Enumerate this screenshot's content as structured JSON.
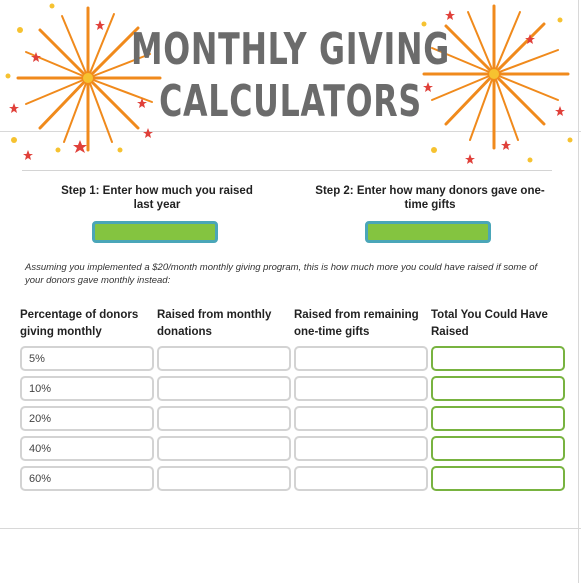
{
  "header": {
    "title_line1": "MONTHLY GIVING",
    "title_line2": "CALCULATORS"
  },
  "steps": {
    "step1_label": "Step 1: Enter how much you raised last year",
    "step1_value": "",
    "step2_label": "Step 2: Enter how many donors gave one-time gifts",
    "step2_value": ""
  },
  "note": "Assuming you implemented a $20/month monthly giving program, this is how much more you could have raised if some of your donors gave monthly instead:",
  "table": {
    "headers": [
      "Percentage of donors giving monthly",
      "Raised from monthly donations",
      "Raised from remaining one-time gifts",
      "Total You Could Have Raised"
    ],
    "rows": [
      {
        "percent": "5%",
        "monthly": "",
        "one_time": "",
        "total": ""
      },
      {
        "percent": "10%",
        "monthly": "",
        "one_time": "",
        "total": ""
      },
      {
        "percent": "20%",
        "monthly": "",
        "one_time": "",
        "total": ""
      },
      {
        "percent": "40%",
        "monthly": "",
        "one_time": "",
        "total": ""
      },
      {
        "percent": "60%",
        "monthly": "",
        "one_time": "",
        "total": ""
      }
    ]
  },
  "colors": {
    "title": "#6b6b6b",
    "input_fill": "#84c440",
    "input_border": "#4aa6b8",
    "total_border": "#78b340",
    "firework_orange": "#f08a1c",
    "star_red": "#e0403a",
    "dot_yellow": "#f6c230"
  },
  "decorations": [
    "firework-left",
    "firework-right"
  ]
}
